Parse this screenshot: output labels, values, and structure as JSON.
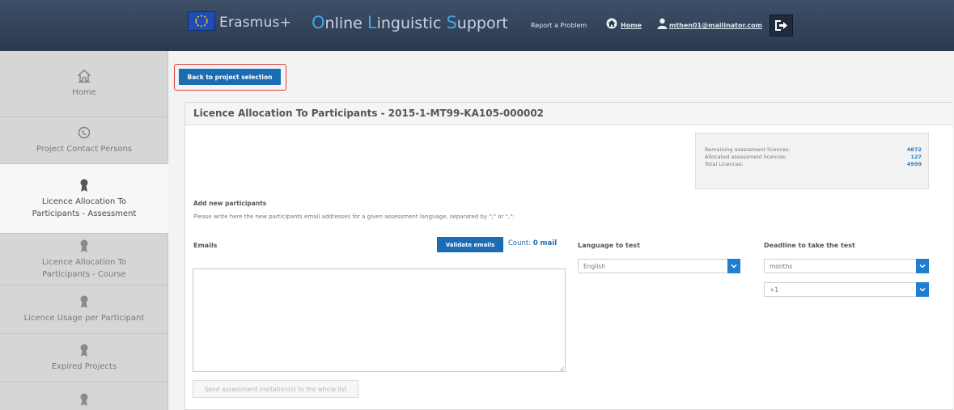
{
  "header": {
    "brand": "Erasmus+",
    "title_parts": [
      {
        "accent": "O",
        "rest": "nline "
      },
      {
        "accent": "L",
        "rest": "inguistic "
      },
      {
        "accent": "S",
        "rest": "upport"
      }
    ],
    "report_problem": "Report a Problem",
    "home_link": "Home",
    "user_email": "mthen01@mailinator.com",
    "icons": [
      "eu-flag",
      "home-icon",
      "user-icon",
      "logout-icon"
    ]
  },
  "sidebar": {
    "items": [
      {
        "label": "Home",
        "icon": "home-icon",
        "active": false
      },
      {
        "label": "Project Contact Persons",
        "icon": "contact-icon",
        "active": false
      },
      {
        "label": "Licence Allocation To\nParticipants - Assessment",
        "icon": "award-icon",
        "active": true
      },
      {
        "label": "Licence Allocation To\nParticipants - Course",
        "icon": "award-icon",
        "active": false
      },
      {
        "label": "Licence Usage per Participant",
        "icon": "award-icon",
        "active": false
      },
      {
        "label": "Expired Projects",
        "icon": "award-icon",
        "active": false
      },
      {
        "label": "",
        "icon": "award-icon",
        "active": false
      }
    ]
  },
  "main": {
    "back_button": "Back to project selection",
    "panel_title": "Licence Allocation To Participants - 2015-1-MT99-KA105-000002",
    "stats": [
      {
        "label": "Remaining assessment licences:",
        "value": "4872"
      },
      {
        "label": "Allocated assessment licences:",
        "value": "127"
      },
      {
        "label": "Total Licences:",
        "value": "4999"
      }
    ],
    "add_title": "Add new participants",
    "add_description": "Please write here the new participants email addresses for a given assessment language, separated by \";\" or \",\":",
    "emails_label": "Emails",
    "validate_button": "Validate emails",
    "count_label": "Count: ",
    "count_value": "0 mail",
    "language_label": "Language to test",
    "language_value": "English",
    "deadline_label": "Deadline to take the test",
    "deadline_unit": "months",
    "deadline_value": "+1",
    "send_button": "Send assessment invitation(s) to the whole list",
    "emails_value": ""
  },
  "colors": {
    "header_bg": "#2b3a4f",
    "primary_button": "#1a6cb5",
    "highlight_border": "#e03c3c",
    "accent_text": "#3fa6e8"
  }
}
